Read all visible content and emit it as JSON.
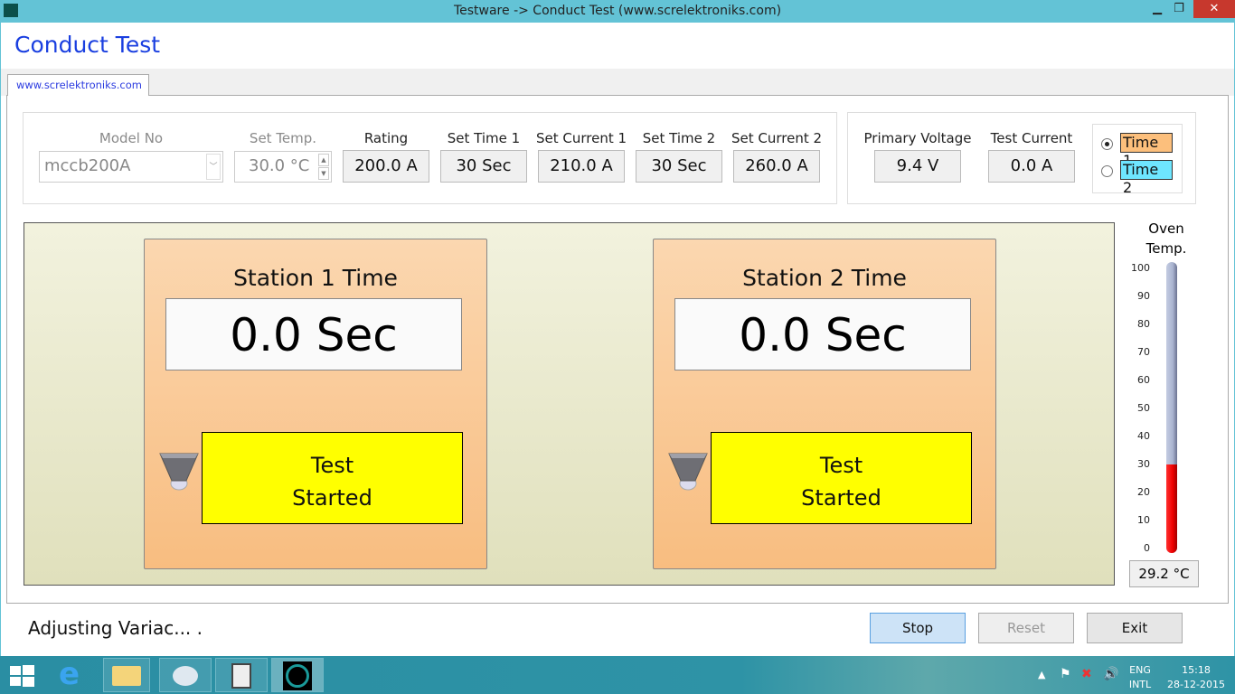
{
  "window": {
    "title": "Testware -> Conduct Test (www.screlektroniks.com)",
    "controls": {
      "minimize": "▁",
      "restore": "❐",
      "close": "✕"
    }
  },
  "app_title": "Conduct Test",
  "tab": "www.screlektroniks.com",
  "settings": {
    "model_no": {
      "label": "Model No",
      "value": "mccb200A"
    },
    "set_temp": {
      "label": "Set Temp.",
      "value": "30.0 °C"
    },
    "rating": {
      "label": "Rating",
      "value": "200.0 A"
    },
    "set_time_1": {
      "label": "Set Time 1",
      "value": "30 Sec"
    },
    "set_current_1": {
      "label": "Set Current 1",
      "value": "210.0 A"
    },
    "set_time_2": {
      "label": "Set Time 2",
      "value": "30 Sec"
    },
    "set_current_2": {
      "label": "Set Current 2",
      "value": "260.0 A"
    }
  },
  "readings": {
    "primary_voltage": {
      "label": "Primary Voltage",
      "value": "9.4 V"
    },
    "test_current": {
      "label": "Test Current",
      "value": "0.0 A"
    },
    "time_select": {
      "options": [
        "Time 1",
        "Time 2"
      ],
      "selected": "Time 1",
      "colors": [
        "#fcbf7c",
        "#6ee6ff"
      ]
    }
  },
  "stations": [
    {
      "title": "Station 1 Time",
      "time": "0.0 Sec",
      "status": "Test\nStarted"
    },
    {
      "title": "Station 2 Time",
      "time": "0.0 Sec",
      "status": "Test\nStarted"
    }
  ],
  "oven": {
    "label": "Oven\nTemp.",
    "value": "29.2 °C",
    "level": 29.2,
    "min": 0,
    "max": 100,
    "ticks": [
      "100",
      "90",
      "80",
      "70",
      "60",
      "50",
      "40",
      "30",
      "20",
      "10",
      "0"
    ],
    "fill_color": "#ff0000"
  },
  "status_message": "Adjusting Variac... .",
  "buttons": {
    "stop": "Stop",
    "reset": "Reset",
    "exit": "Exit"
  },
  "taskbar": {
    "lang": "ENG",
    "layout": "INTL",
    "time": "15:18",
    "date": "28-12-2015"
  }
}
